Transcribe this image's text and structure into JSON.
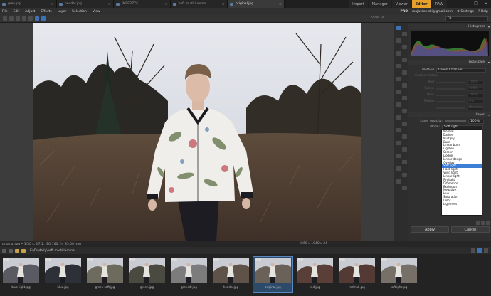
{
  "tabs": [
    {
      "label": "grey.jpg",
      "active": false
    },
    {
      "label": "header.jpg",
      "active": false
    },
    {
      "label": "JMBER7OF",
      "active": false
    },
    {
      "label": "soft multi lumino",
      "active": false
    },
    {
      "label": "original.jpg",
      "active": true
    }
  ],
  "modes": [
    "Import",
    "Manager",
    "Viewer",
    "Editor",
    "RAW"
  ],
  "active_mode": "Editor",
  "window_controls": [
    "—",
    "❐",
    "✕"
  ],
  "menu": [
    "File",
    "Edit",
    "Adjust",
    "Effects",
    "Layer",
    "Selection",
    "View"
  ],
  "account": {
    "tier": "PRO",
    "email": "majaskac.ski@gmail.com",
    "settings": "Settings",
    "help": "Help"
  },
  "toolbar": {
    "zoom_label": "Zoom Fit",
    "fit_value": "Fit"
  },
  "panel": {
    "histogram_title": "Histogram",
    "grayscale_title": "Grayscale",
    "method_label": "Method",
    "method_value": "Green Channel",
    "sub_label": "Custom Values",
    "dim_rows": [
      {
        "label": "Red",
        "value": "100%"
      },
      {
        "label": "Green",
        "value": "100%"
      },
      {
        "label": "Blue",
        "value": "100%"
      },
      {
        "label": "Toning",
        "value": "0%"
      },
      {
        "label": "",
        "value": "Blending"
      }
    ],
    "layer_title": "Layer",
    "opacity_label": "Layer opacity:",
    "opacity_value": "100%",
    "mode_label": "Mode:",
    "mode_value": "Soft light",
    "blend_modes": [
      "Normal",
      "Darken",
      "Multiply",
      "Burn",
      "Linear burn",
      "Lighten",
      "Screen",
      "Dodge",
      "Linear dodge",
      "Overlay",
      "Soft light",
      "Hard light",
      "Vivid light",
      "Linear light",
      "Pin light",
      "Difference",
      "Exclusion",
      "Negative",
      "Hue",
      "Saturation",
      "Color",
      "Lightness"
    ],
    "selected_blend": "Soft light",
    "apply_label": "Apply",
    "cancel_label": "Cancel"
  },
  "status": {
    "left": "original.jpg • 1/30 s, f/7.1, ISO 160, f= 35.00 mm",
    "right": "1560 x 1040 x 24"
  },
  "path": "E:\\Ps\\daily\\soft multi lumino",
  "thumbnails": [
    {
      "label": "blue light.jpg",
      "tone": "#5a5a62",
      "active": false
    },
    {
      "label": "blue.jpg",
      "tone": "#2e3038",
      "active": false
    },
    {
      "label": "green soft.jpg",
      "tone": "#6d6a5e",
      "active": false
    },
    {
      "label": "green.jpg",
      "tone": "#4a4a40",
      "active": false
    },
    {
      "label": "grey.rdr.jpg",
      "tone": "#7c7c7c",
      "active": false
    },
    {
      "label": "header.jpg",
      "tone": "#5e5249",
      "active": false
    },
    {
      "label": "original.jpg",
      "tone": "#6a6158",
      "active": true
    },
    {
      "label": "red.jpg",
      "tone": "#5a3e38",
      "active": false
    },
    {
      "label": "redmull.jpg",
      "tone": "#533a34",
      "active": false
    },
    {
      "label": "softlight.jpg",
      "tone": "#767068",
      "active": false
    }
  ]
}
